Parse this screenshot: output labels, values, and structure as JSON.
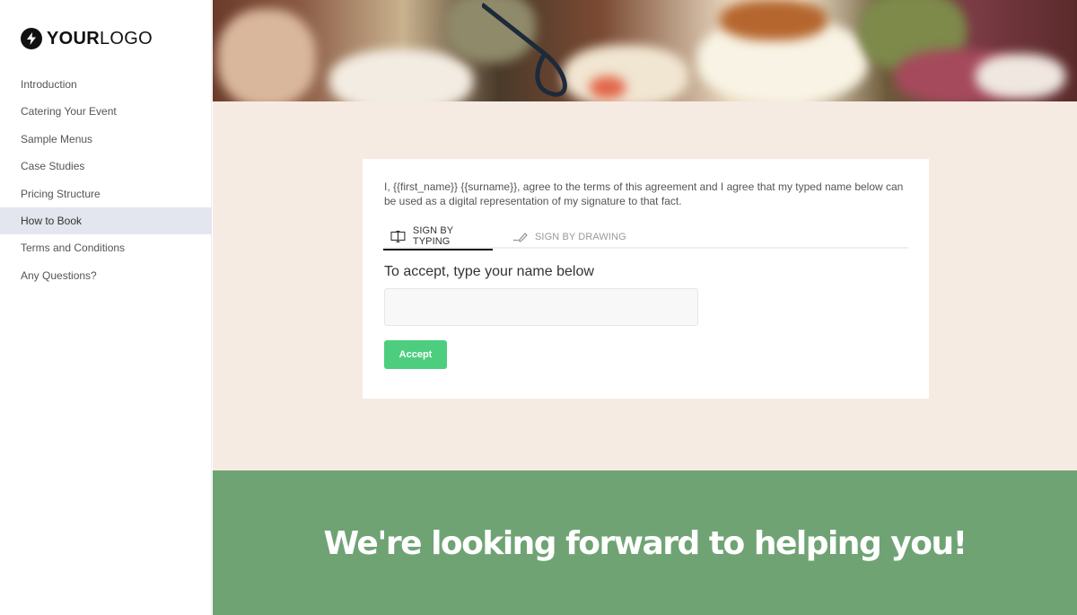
{
  "logo": {
    "bold": "YOUR",
    "regular": "LOGO",
    "icon": "lightning-bolt-icon"
  },
  "sidebar": {
    "items": [
      {
        "label": "Introduction",
        "active": false
      },
      {
        "label": "Catering Your Event",
        "active": false
      },
      {
        "label": "Sample Menus",
        "active": false
      },
      {
        "label": "Case Studies",
        "active": false
      },
      {
        "label": "Pricing Structure",
        "active": false
      },
      {
        "label": "How to Book",
        "active": true
      },
      {
        "label": "Terms and Conditions",
        "active": false
      },
      {
        "label": "Any Questions?",
        "active": false
      }
    ]
  },
  "hero": {
    "image": "catering-food-banner"
  },
  "signature": {
    "agreement_text": "I, {{first_name}} {{surname}}, agree to the terms of this agreement and I agree that my typed name below can be used as a digital representation of my signature to that fact.",
    "tabs": [
      {
        "label": "SIGN BY TYPING",
        "icon": "keyboard-cursor-icon",
        "active": true
      },
      {
        "label": "SIGN BY DRAWING",
        "icon": "pen-signature-icon",
        "active": false
      }
    ],
    "field_label": "To accept, type your name below",
    "input_value": "",
    "input_placeholder": "",
    "accept_label": "Accept"
  },
  "footer": {
    "message": "We're looking forward to helping you!"
  },
  "colors": {
    "accent_green": "#4cce7e",
    "footer_green": "#6fa374",
    "content_bg": "#f6ebe3",
    "active_nav_bg": "#e3e6ee"
  }
}
